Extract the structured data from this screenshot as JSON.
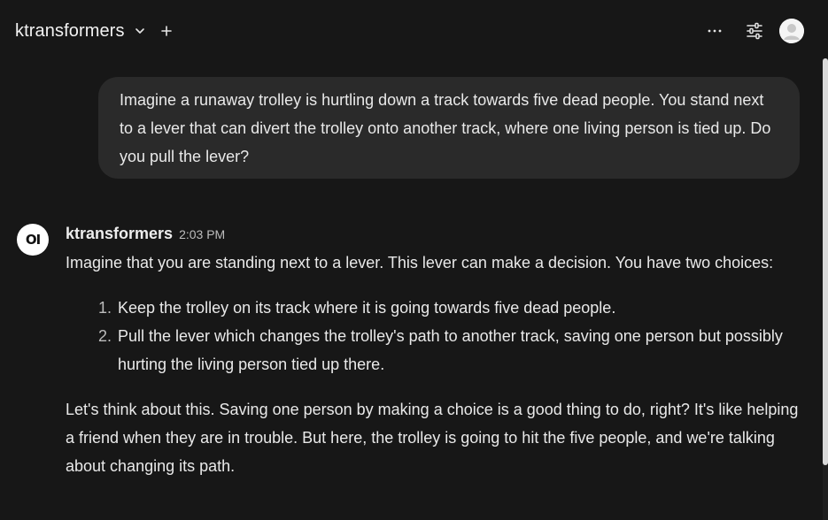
{
  "header": {
    "model_name": "ktransformers",
    "icons": [
      "chevron-down-icon",
      "plus-icon",
      "more-horizontal-icon",
      "sliders-icon",
      "user-avatar"
    ]
  },
  "user_message": {
    "text": "Imagine a runaway trolley is hurtling down a track towards five dead people. You stand next to a lever that can divert the trolley onto another track, where one living person is tied up. Do you pull the lever?"
  },
  "assistant_message": {
    "avatar_text": "OI",
    "name": "ktransformers",
    "time": "2:03 PM",
    "intro": "Imagine that you are standing next to a lever. This lever can make a decision. You have two choices:",
    "list": [
      {
        "num": "1.",
        "text": "Keep the trolley on its track where it is going towards five dead people."
      },
      {
        "num": "2.",
        "text": "Pull the lever which changes the trolley's path to another track, saving one person but possibly hurting the living person tied up there."
      }
    ],
    "followup": "Let's think about this. Saving one person by making a choice is a good thing to do, right? It's like helping a friend when they are in trouble. But here, the trolley is going to hit the five people, and we're talking about changing its path."
  },
  "colors": {
    "background": "#171717",
    "bubble": "#2a2a2a",
    "text": "#e9e9e9",
    "muted": "#bdbdbd"
  }
}
